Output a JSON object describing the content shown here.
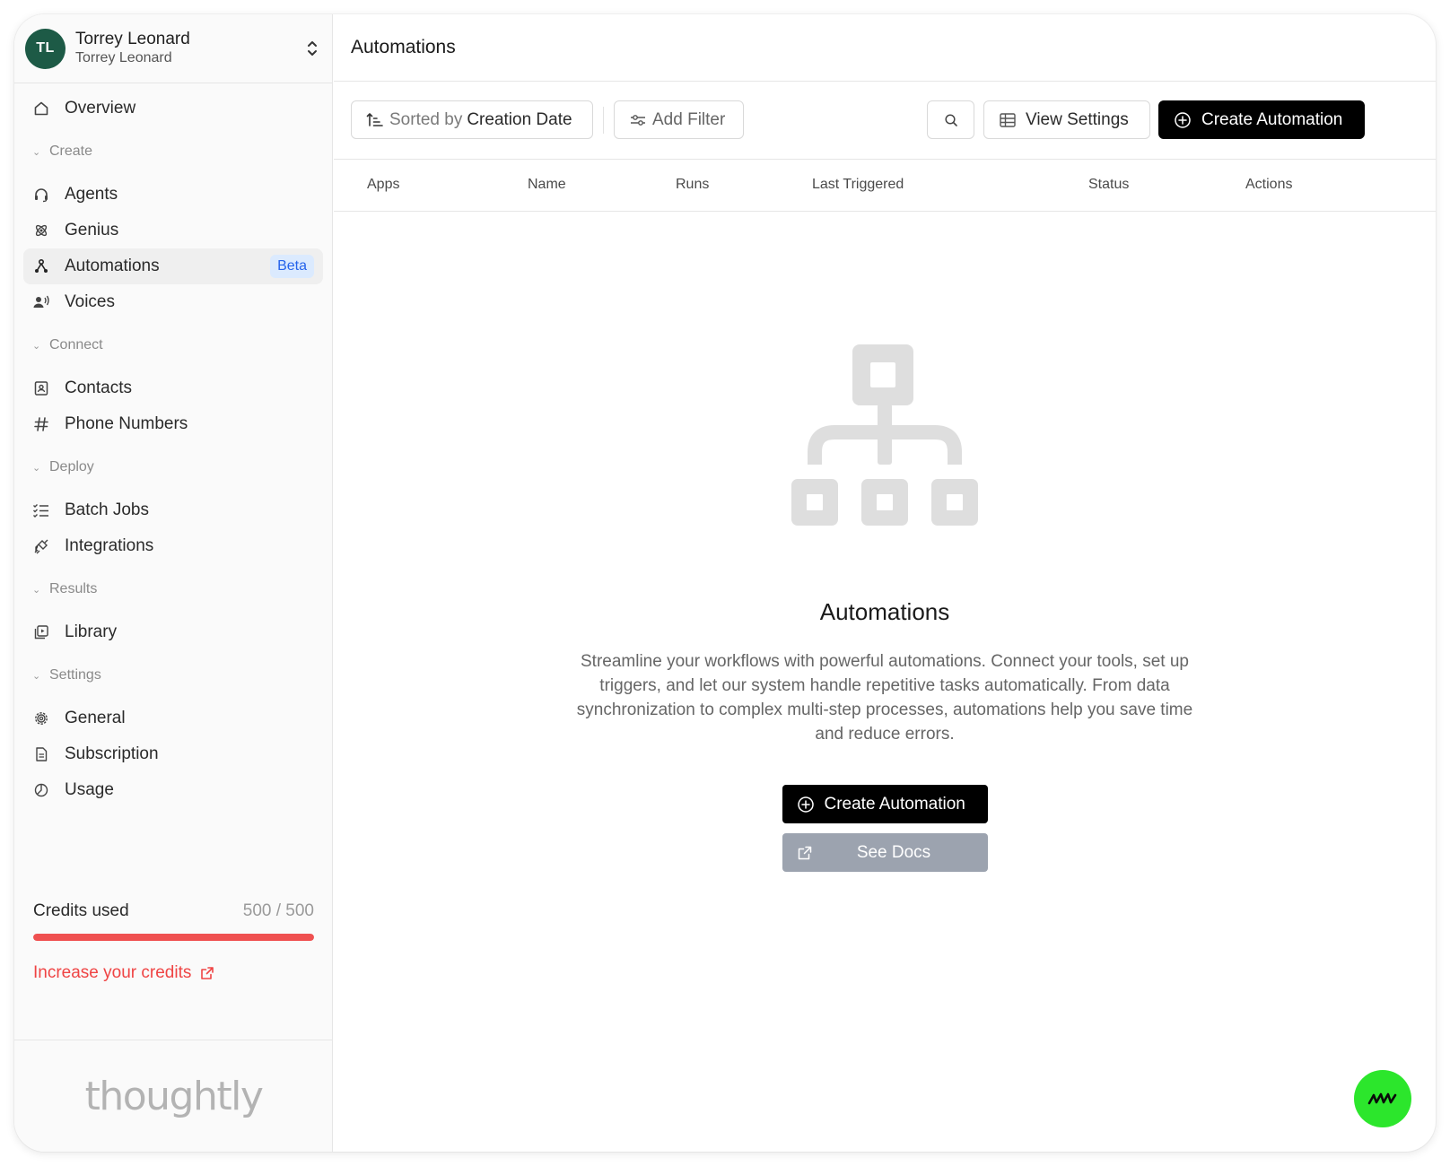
{
  "account": {
    "initials": "TL",
    "name": "Torrey Leonard",
    "org": "Torrey Leonard"
  },
  "nav": {
    "overview": "Overview",
    "sections": {
      "create": "Create",
      "connect": "Connect",
      "deploy": "Deploy",
      "results": "Results",
      "settings": "Settings"
    },
    "items": {
      "agents": "Agents",
      "genius": "Genius",
      "automations": "Automations",
      "automations_badge": "Beta",
      "voices": "Voices",
      "contacts": "Contacts",
      "phone_numbers": "Phone Numbers",
      "batch_jobs": "Batch Jobs",
      "integrations": "Integrations",
      "library": "Library",
      "general": "General",
      "subscription": "Subscription",
      "usage": "Usage"
    }
  },
  "credits": {
    "label": "Credits used",
    "value": "500 / 500",
    "used_fraction": 1.0,
    "increase_label": "Increase your credits"
  },
  "brand": {
    "logo_text": "thoughtly"
  },
  "header": {
    "title": "Automations"
  },
  "toolbar": {
    "sort_prefix": "Sorted by",
    "sort_value": "Creation Date",
    "filter_label": "Add Filter",
    "view_settings_label": "View Settings",
    "create_label": "Create Automation"
  },
  "table": {
    "columns": [
      "Apps",
      "Name",
      "Runs",
      "Last Triggered",
      "Status",
      "Actions"
    ]
  },
  "empty_state": {
    "title": "Automations",
    "description": "Streamline your workflows with powerful automations. Connect your tools, set up triggers, and let our system handle repetitive tasks automatically. From data synchronization to complex multi-step processes, automations help you save time and reduce errors.",
    "create_label": "Create Automation",
    "docs_label": "See Docs"
  },
  "colors": {
    "accent_green": "#2ce62c",
    "avatar_bg": "#1d5a46",
    "credits_red": "#ef5050",
    "beta_bg": "#dbeafe",
    "beta_text": "#2563eb"
  }
}
